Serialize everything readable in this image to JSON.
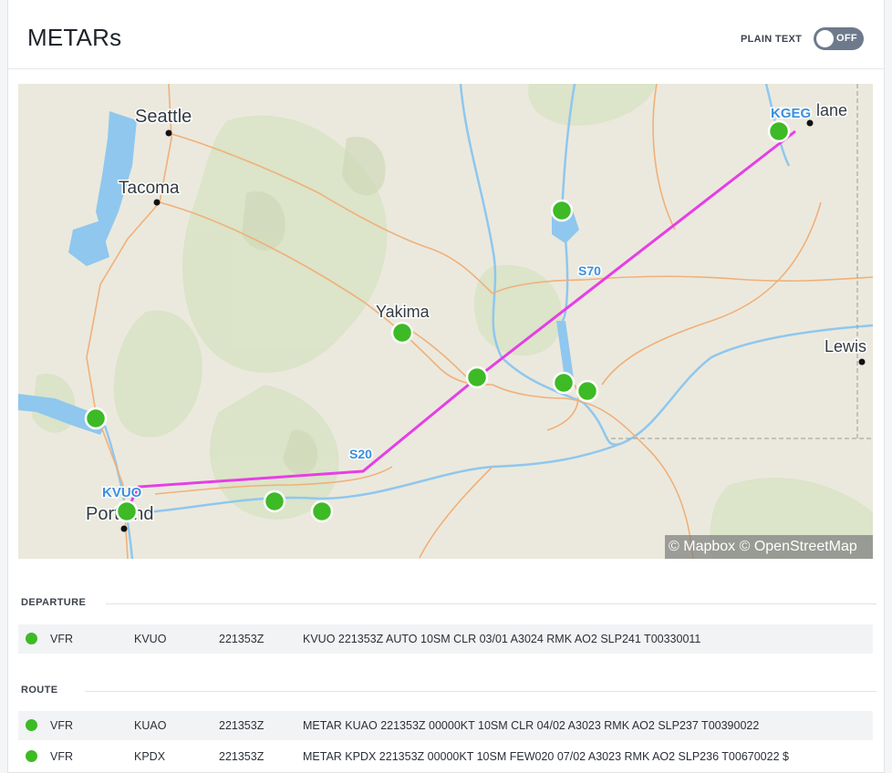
{
  "header": {
    "title": "METARs",
    "toggle_label": "PLAIN TEXT",
    "toggle_state": "OFF"
  },
  "map": {
    "labels": {
      "seattle": "Seattle",
      "tacoma": "Tacoma",
      "yakima": "Yakima",
      "lewis": "Lewis",
      "spokane_tail": "lane",
      "portland": "Portland"
    },
    "route": {
      "departure": "KVUO",
      "destination": "KGEG",
      "segments": [
        "S20",
        "S70"
      ],
      "color": "#e63ee6"
    },
    "station_color": "#3dba25",
    "attribution": "© Mapbox © OpenStreetMap"
  },
  "sections": {
    "departure": "DEPARTURE",
    "route": "ROUTE"
  },
  "departure_rows": [
    {
      "category": "VFR",
      "station": "KVUO",
      "time": "221353Z",
      "metar": "KVUO 221353Z AUTO 10SM CLR 03/01 A3024 RMK AO2 SLP241 T00330011"
    }
  ],
  "route_rows": [
    {
      "category": "VFR",
      "station": "KUAO",
      "time": "221353Z",
      "metar": "METAR KUAO 221353Z 00000KT 10SM CLR 04/02 A3023 RMK AO2 SLP237 T00390022"
    },
    {
      "category": "VFR",
      "station": "KPDX",
      "time": "221353Z",
      "metar": "METAR KPDX 221353Z 00000KT 10SM FEW020 07/02 A3023 RMK AO2 SLP236 T00670022 $"
    }
  ]
}
